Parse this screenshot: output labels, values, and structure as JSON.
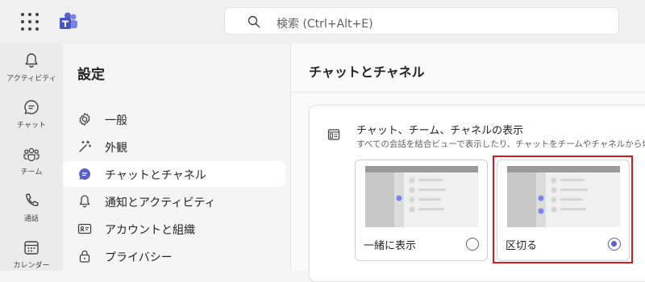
{
  "search": {
    "placeholder": "検索 (Ctrl+Alt+E)"
  },
  "rail": [
    {
      "label": "アクティビティ",
      "icon": "bell-icon"
    },
    {
      "label": "チャット",
      "icon": "chat-icon"
    },
    {
      "label": "チーム",
      "icon": "teams-icon"
    },
    {
      "label": "通話",
      "icon": "phone-icon"
    },
    {
      "label": "カレンダー",
      "icon": "calendar-icon"
    }
  ],
  "settings": {
    "title": "設定",
    "items": [
      {
        "label": "一般",
        "icon": "gear-icon"
      },
      {
        "label": "外観",
        "icon": "magic-wand-icon"
      },
      {
        "label": "チャットとチャネル",
        "icon": "chat-bubble-icon",
        "active": true
      },
      {
        "label": "通知とアクティビティ",
        "icon": "bell-icon"
      },
      {
        "label": "アカウントと組織",
        "icon": "id-card-icon"
      },
      {
        "label": "プライバシー",
        "icon": "lock-icon"
      }
    ]
  },
  "main": {
    "title": "チャットとチャネル",
    "card": {
      "title": "チャット、チーム、チャネルの表示",
      "description": "すべての会話を結合ビューで表示したり、チャットをチームやチャネルから切り",
      "options": [
        {
          "label": "一緒に表示",
          "selected": false
        },
        {
          "label": "区切る",
          "selected": true
        }
      ]
    }
  },
  "colors": {
    "accent": "#5b5fc7",
    "highlight": "#d6191d"
  }
}
